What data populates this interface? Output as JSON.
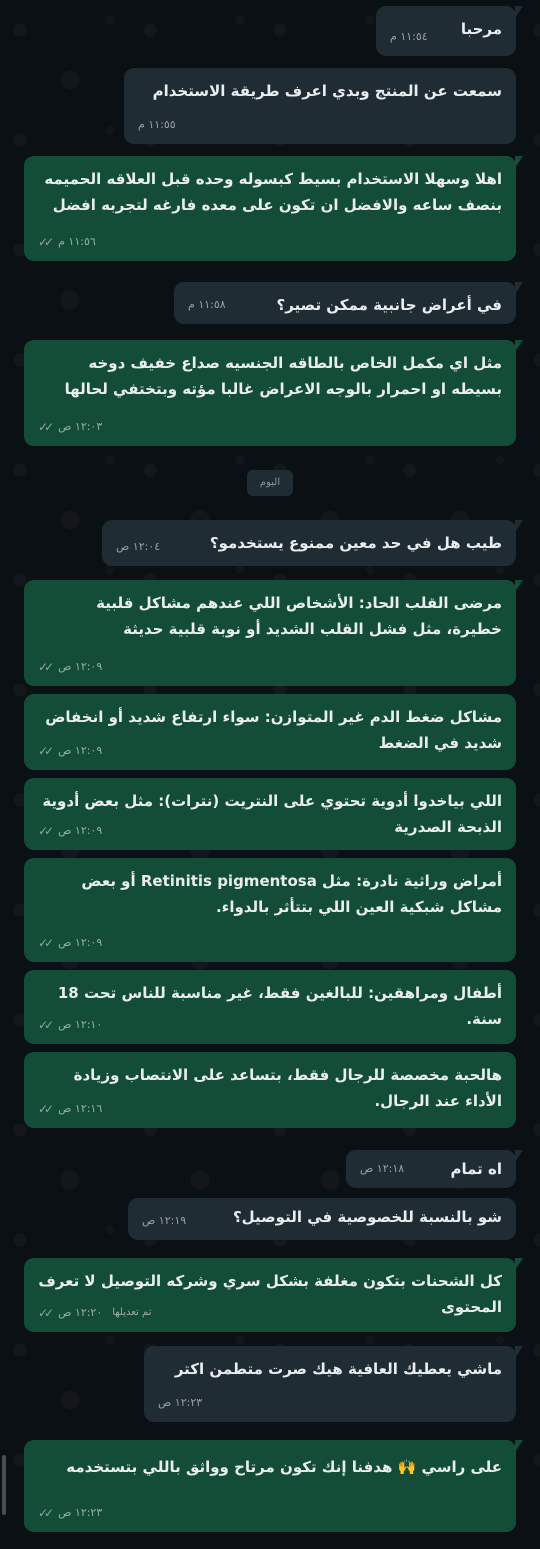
{
  "day_label": "اليوم",
  "messages": [
    {
      "dir": "in",
      "text": "مرحبا",
      "time": "١١:٥٤ م"
    },
    {
      "dir": "in",
      "text": "سمعت عن المنتج وبدي اعرف طريقة الاستخدام",
      "time": "١١:٥٥ م"
    },
    {
      "dir": "out",
      "text": "اهلا وسهلا الاستخدام بسيط كبسوله وحده قبل العلاقه الحميمه بنصف ساعه والافضل ان تكون على معده فارغه لتجربه افضل",
      "time": "١١:٥٦ م"
    },
    {
      "dir": "in",
      "text": "في أعراض جانبية ممكن تصير؟",
      "time": "١١:٥٨ م"
    },
    {
      "dir": "out",
      "text": "مثل اي مكمل الخاص بالطاقه الجنسيه صداع خفيف دوخه بسيطه او احمرار بالوجه الاعراض غالبا مؤته وبتختفي لحالها",
      "time": "١٢:٠٣ ص"
    },
    {
      "dir": "in",
      "text": "طيب هل في حد معين ممنوع يستخدمو؟",
      "time": "١٢:٠٤ ص"
    },
    {
      "dir": "out",
      "text": "مرضى القلب الحاد: الأشخاص اللي عندهم مشاكل قلبية خطيرة، مثل فشل القلب الشديد أو نوبة قلبية حديثة",
      "time": "١٢:٠٩ ص"
    },
    {
      "dir": "out",
      "text": "مشاكل ضغط الدم غير المتوازن: سواء ارتفاع شديد أو انخفاض شديد في الضغط",
      "time": "١٢:٠٩ ص"
    },
    {
      "dir": "out",
      "text": "اللي بياخدوا أدوية تحتوي على النتريت (نترات): مثل بعض أدوية الذبحة الصدرية",
      "time": "١٢:٠٩ ص"
    },
    {
      "dir": "out",
      "text": "أمراض وراثية نادرة: مثل Retinitis pigmentosa أو بعض مشاكل شبكية العين اللي بتتأثر بالدواء.",
      "time": "١٢:٠٩ ص"
    },
    {
      "dir": "out",
      "text": "أطفال ومراهقين: للبالغين فقط، غير مناسبة للناس تحت 18 سنة.",
      "time": "١٢:١٠ ص"
    },
    {
      "dir": "out",
      "text": "هالحبة مخصصة للرجال فقط، بتساعد على الانتصاب وزيادة الأداء عند الرجال.",
      "time": "١٢:١٦ ص"
    },
    {
      "dir": "in",
      "text": "اه تمام",
      "time": "١٢:١٨ ص"
    },
    {
      "dir": "in",
      "text": "شو بالنسبة للخصوصية في التوصيل؟",
      "time": "١٢:١٩ ص"
    },
    {
      "dir": "out",
      "text": "كل الشحنات بتكون مغلفة بشكل سري وشركه التوصيل لا تعرف المحتوى",
      "time": "١٢:٢٠ ص",
      "edited": "تم تعديلها"
    },
    {
      "dir": "in",
      "text": "ماشي يعطيك العافية هيك صرت متطمن اكتر",
      "time": "١٢:٢٣ ص"
    },
    {
      "dir": "out",
      "text": "على راسي 🙌 هدفنا إنك تكون مرتاح وواثق باللي بتستخدمه",
      "time": "١٢:٢٣ ص"
    }
  ],
  "ticks_icon": "double-check"
}
